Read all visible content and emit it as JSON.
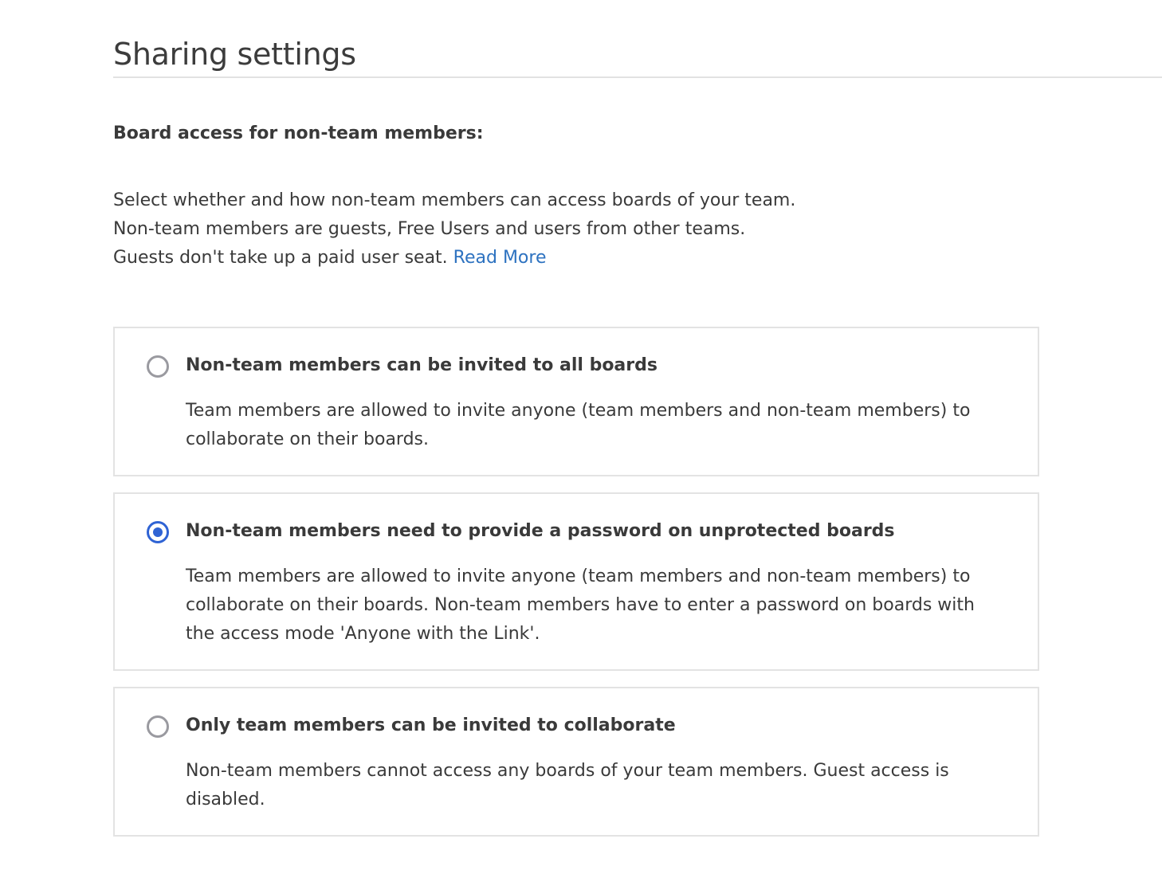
{
  "page": {
    "title": "Sharing settings"
  },
  "section": {
    "heading": "Board access for non-team members:",
    "description_lines": [
      "Select whether and how non-team members can access boards of your team.",
      "Non-team members are guests, Free Users and users from other teams.",
      "Guests don't take up a paid user seat."
    ],
    "read_more_label": "Read More"
  },
  "options": [
    {
      "title": "Non-team members can be invited to all boards",
      "description_lines": [
        "Team members are allowed to invite anyone (team members and non-team members) to",
        "collaborate on their boards."
      ],
      "selected": false
    },
    {
      "title": "Non-team members need to provide a password on unprotected boards",
      "description_lines": [
        "Team members are allowed to invite anyone (team members and non-team members) to",
        "collaborate on their boards. Non-team members have to enter a password on boards with",
        "the access mode 'Anyone with the Link'."
      ],
      "selected": true
    },
    {
      "title": "Only team members can be invited to collaborate",
      "description_lines": [
        "Non-team members cannot access any boards of your team members. Guest access is",
        "disabled."
      ],
      "selected": false
    }
  ],
  "colors": {
    "accent": "#2f63d4",
    "link": "#2d72c0",
    "radio_unselected": "#9a9aa0",
    "card_border": "#e3e3e3"
  }
}
